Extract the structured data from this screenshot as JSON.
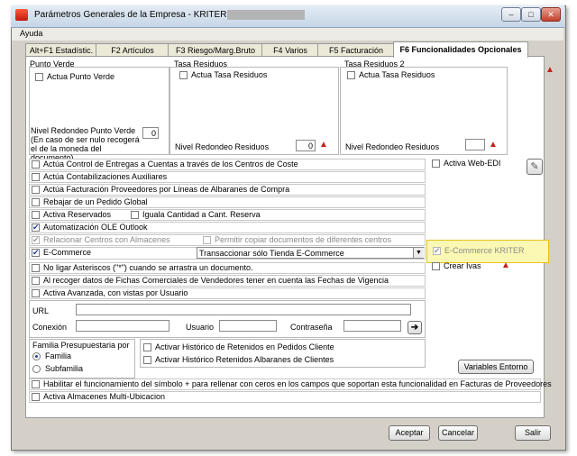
{
  "window": {
    "title": "Parámetros Generales de la Empresa - KRITER ERP - [",
    "min_glyph": "–",
    "max_glyph": "□",
    "close_glyph": "✕"
  },
  "menu": {
    "ayuda": "Ayuda"
  },
  "tabs": [
    {
      "label": "Alt+F1 Estadístic."
    },
    {
      "label": "F2 Artículos"
    },
    {
      "label": "F3 Riesgo/Marg.Bruto"
    },
    {
      "label": "F4 Varios"
    },
    {
      "label": "F5 Facturación"
    },
    {
      "label": "F6 Funcionalidades Opcionales"
    }
  ],
  "punto_verde": {
    "title": "Punto Verde",
    "actua": "Actua Punto Verde",
    "redondeo_label": "Nivel Redondeo Punto Verde (En caso de ser nulo recogerá el de la moneda del documento).",
    "redondeo_value": "0"
  },
  "tasa_residuos": {
    "title": "Tasa Residuos",
    "actua": "Actua Tasa Residuos",
    "redondeo_label": "Nivel Redondeo Residuos",
    "redondeo_value": "0"
  },
  "tasa_residuos2": {
    "title": "Tasa Residuos 2",
    "actua": "Actua Tasa Residuos",
    "redondeo_label": "Nivel Redondeo Residuos",
    "redondeo_value": ""
  },
  "options": {
    "control_entregas": "Actúa Control de Entregas a Cuentas a través de los Centros de Coste",
    "contabilizaciones": "Actúa Contabilizaciones Auxiliares",
    "facturacion_proveedores": "Actúa Facturación Proveedores por Líneas de Albaranes de Compra",
    "rebajar_pedido": "Rebajar de un Pedido Global",
    "activa_reservados": "Activa Reservados",
    "iguala_cantidad": "Iguala Cantidad a Cant. Reserva",
    "automatizacion_ole": "Automatización OLE Outlook",
    "relacionar_centros": "Relacionar Centros con Almacenes",
    "permitir_copiar": "Permitir copiar documentos de diferentes centros",
    "ecommerce": "E-Commerce",
    "ecommerce_select": "Transaccionar sólo Tienda E-Commerce",
    "no_ligar": "No ligar Asteriscos (\"*\") cuando se arrastra un documento.",
    "al_recoger": "Al recoger datos de Fichas Comerciales de Vendedores tener en cuenta las Fechas de Vigencia",
    "activa_avanzada": "Activa Avanzada, con vistas por Usuario",
    "activa_webedi": "Activa Web-EDI",
    "ecommerce_kriter": "E-Commerce KRITER",
    "crear_ivas": "Crear Ivas",
    "habilitar_simbolo": "Habilitar el funcionamiento del símbolo + para rellenar con ceros en los campos que soportan esta funcionalidad en Facturas de Proveedores",
    "activa_almacenes": "Activa Almacenes Multi-Ubicacion"
  },
  "connection": {
    "url_label": "URL",
    "url_value": "",
    "conexion_label": "Conexión",
    "usuario_label": "Usuario",
    "contrasena_label": "Contraseña",
    "go_glyph": "➔"
  },
  "familia": {
    "title": "Familia Presupuestaria por",
    "opt1": "Familia",
    "opt2": "Subfamilia",
    "hist_pedidos": "Activar Histórico de Retenidos en Pedidos Cliente",
    "hist_albaranes": "Activar Histórico Retenidos Albaranes de Clientes",
    "variables_entorno": "Variables Entorno"
  },
  "buttons": {
    "aceptar": "Aceptar",
    "cancelar": "Cancelar",
    "salir": "Salir"
  },
  "colors": {
    "highlight": "#fbf8b4",
    "highlight_border": "#e6c21a",
    "check": "#21409a"
  }
}
